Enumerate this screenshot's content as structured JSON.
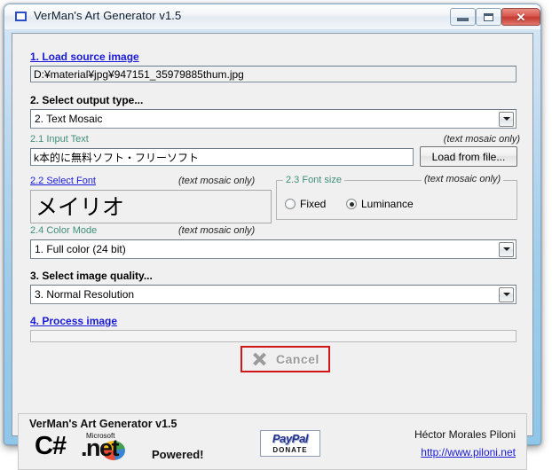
{
  "window": {
    "title": "VerMan's Art Generator v1.5",
    "icon": "app-window-icon",
    "controls": {
      "minimize": "minimize-icon",
      "maximize": "maximize-icon",
      "close": "✕"
    }
  },
  "steps": {
    "load_source": {
      "link_label": "1. Load source image",
      "path_value": "D:¥material¥jpg¥947151_35979885thum.jpg"
    },
    "output_type": {
      "heading": "2. Select output type...",
      "selected": "2. Text Mosaic"
    },
    "input_text": {
      "label": "2.1 Input Text",
      "hint": "(text mosaic only)",
      "value": "k本的に無料ソフト・フリーソフト",
      "load_button": "Load from file..."
    },
    "select_font": {
      "label": "2.2 Select Font",
      "hint": "(text mosaic only)",
      "preview": "メイリオ"
    },
    "font_size": {
      "label": "2.3 Font size",
      "hint": "(text mosaic only)",
      "options": [
        {
          "label": "Fixed",
          "selected": false
        },
        {
          "label": "Luminance",
          "selected": true
        }
      ]
    },
    "color_mode": {
      "label": "2.4 Color Mode",
      "hint": "(text mosaic only)",
      "selected": "1. Full color (24 bit)"
    },
    "image_quality": {
      "heading": "3. Select image quality...",
      "selected": "3. Normal Resolution"
    },
    "process": {
      "link_label": "4. Process image",
      "progress_value": "",
      "cancel_label": "Cancel",
      "cancel_icon": "cancel-x-icon"
    }
  },
  "footer": {
    "product_title": "VerMan's Art Generator v1.5",
    "tech_csharp": "C#",
    "tech_microsoft": "Microsoft",
    "tech_net": ".net",
    "tech_powered": "Powered!",
    "paypal_word": "PayPal",
    "paypal_donate": "DONATE",
    "author_name": "Héctor Morales Piloni",
    "author_url": "http://www.piloni.net"
  },
  "colors": {
    "link": "#1a1ad6",
    "sublabel": "#3f8f77",
    "cancel_border": "#d01616",
    "close_button": "#c33a31"
  }
}
